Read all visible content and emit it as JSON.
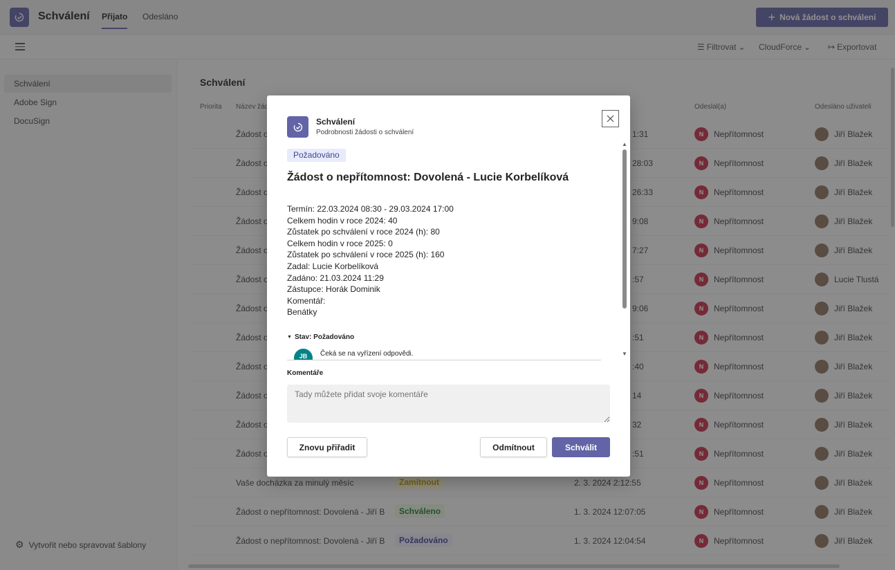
{
  "app": {
    "title": "Schválení",
    "tabs": [
      {
        "label": "Přijato",
        "active": true
      },
      {
        "label": "Odesláno",
        "active": false
      }
    ],
    "new_request_label": "Nová žádost o schválení"
  },
  "toolbar": {
    "filter_label": "Filtrovat",
    "source_label": "CloudForce",
    "export_label": "Exportovat"
  },
  "sidebar": {
    "items": [
      {
        "label": "Schválení",
        "active": true
      },
      {
        "label": "Adobe Sign",
        "active": false
      },
      {
        "label": "DocuSign",
        "active": false
      }
    ],
    "footer_label": "Vytvořit nebo spravovat šablony"
  },
  "main": {
    "title": "Schválení",
    "columns": {
      "priority": "Priorita",
      "name": "Název žád",
      "sent_by": "Odeslal(a)",
      "sent_to": "Odesláno uživateli"
    },
    "rows": [
      {
        "name": "Žádost o",
        "time": "1:31",
        "sender": "Nepřítomnost",
        "user": "Jiří Blažek"
      },
      {
        "name": "Žádost o",
        "time": "28:03",
        "sender": "Nepřítomnost",
        "user": "Jiří Blažek"
      },
      {
        "name": "Žádost o",
        "time": "26:33",
        "sender": "Nepřítomnost",
        "user": "Jiří Blažek"
      },
      {
        "name": "Žádost o",
        "time": "9:08",
        "sender": "Nepřítomnost",
        "user": "Jiří Blažek"
      },
      {
        "name": "Žádost o",
        "time": "7:27",
        "sender": "Nepřítomnost",
        "user": "Jiří Blažek"
      },
      {
        "name": "Žádost o",
        "time": ":57",
        "sender": "Nepřítomnost",
        "user": "Lucie Tlustá"
      },
      {
        "name": "Žádost o",
        "time": "9:06",
        "sender": "Nepřítomnost",
        "user": "Jiří Blažek"
      },
      {
        "name": "Žádost o",
        "time": ":51",
        "sender": "Nepřítomnost",
        "user": "Jiří Blažek"
      },
      {
        "name": "Žádost o",
        "time": ":40",
        "sender": "Nepřítomnost",
        "user": "Jiří Blažek"
      },
      {
        "name": "Žádost o",
        "time": "14",
        "sender": "Nepřítomnost",
        "user": "Jiří Blažek"
      },
      {
        "name": "Žádost o",
        "time": "32",
        "sender": "Nepřítomnost",
        "user": "Jiří Blažek"
      },
      {
        "name": "Žádost o",
        "time": ":51",
        "sender": "Nepřítomnost",
        "user": "Jiří Blažek"
      },
      {
        "name": "Vaše docházka za minulý měsíc",
        "status": "Zamítnout",
        "status_color": "#c19c00",
        "status_bg": "#fbf6d9",
        "time": "2. 3. 2024 2:12:55",
        "sender": "Nepřítomnost",
        "user": "Jiří Blažek"
      },
      {
        "name": "Žádost o nepřítomnost: Dovolená - Jiří B",
        "status": "Schváleno",
        "status_color": "#237b4b",
        "status_bg": "#e7f2da",
        "time": "1. 3. 2024 12:07:05",
        "sender": "Nepřítomnost",
        "user": "Jiří Blažek"
      },
      {
        "name": "Žádost o nepřítomnost: Dovolená - Jiří B",
        "status": "Požadováno",
        "status_color": "#444791",
        "status_bg": "#e8ebfa",
        "time": "1. 3. 2024 12:04:54",
        "sender": "Nepřítomnost",
        "user": "Jiří Blažek"
      }
    ],
    "sender_initial": "N"
  },
  "dialog": {
    "title": "Schválení",
    "subtitle": "Podrobnosti žádosti o schválení",
    "badge": "Požadováno",
    "request_title": "Žádost o nepřítomnost: Dovolená - Lucie Korbelíková",
    "details": [
      "Termín: 22.03.2024 08:30 - 29.03.2024 17:00",
      "Celkem hodin v roce 2024: 40",
      "Zůstatek po schválení v roce 2024 (h): 80",
      "Celkem hodin v roce 2025: 0",
      "Zůstatek po schválení v roce 2025 (h): 160",
      "Zadal: Lucie Korbelíková",
      "Zadáno: 21.03.2024 11:29",
      "Zástupce: Horák Dominik",
      "Komentář:",
      "Benátky"
    ],
    "status_heading": "Stav: Požadováno",
    "approver_initials": "JB",
    "waiting_text": "Čeká se na vyřízení odpovědi.",
    "comments_label": "Komentáře",
    "comments_placeholder": "Tady můžete přidat svoje komentáře",
    "reassign_label": "Znovu přiřadit",
    "reject_label": "Odmítnout",
    "approve_label": "Schválit"
  },
  "colors": {
    "brand": "#6264a7",
    "danger": "#c4314b",
    "teal": "#038387"
  }
}
